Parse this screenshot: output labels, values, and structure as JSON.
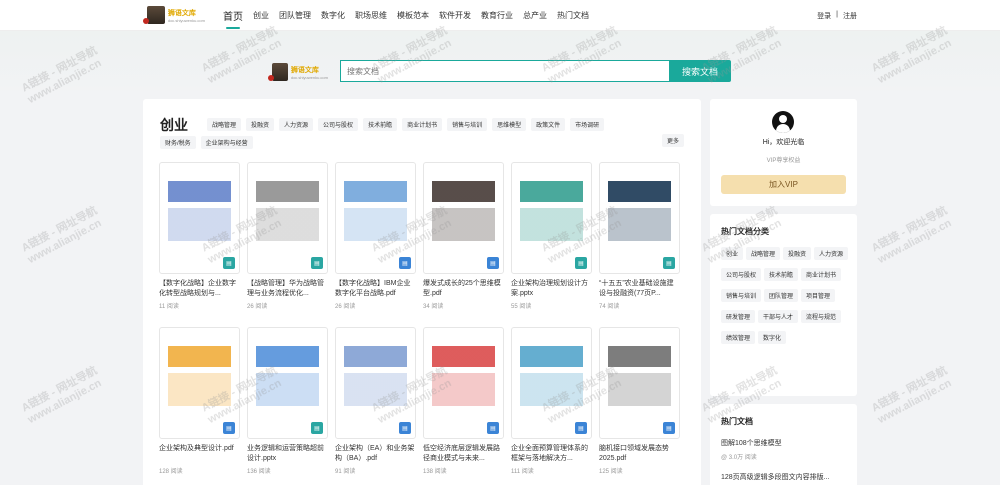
{
  "nav": {
    "logo_cn": "狮语文库",
    "logo_url": "doc.shiyuwenku.com",
    "items": [
      "首页",
      "创业",
      "团队管理",
      "数字化",
      "职场思维",
      "模板范本",
      "软件开发",
      "教育行业",
      "总产业",
      "热门文档"
    ],
    "login": "登录",
    "separator": "|",
    "register": "注册"
  },
  "search": {
    "placeholder": "搜索文档",
    "button": "搜索文档"
  },
  "category": {
    "title": "创业",
    "tags": [
      "战略管理",
      "投融资",
      "人力资源",
      "公司与股权",
      "技术前瞻",
      "商业计划书",
      "销售与培训",
      "思维模型",
      "政策文件",
      "市场调研"
    ],
    "tags_row2": [
      "财务/税务",
      "企业架构与经营"
    ],
    "more": "更多"
  },
  "docs": [
    {
      "title": "【数字化战略】企业数字化转型战略规划与...",
      "reads": "11 阅读",
      "fmt": "ppt",
      "color": "#5b7dc7"
    },
    {
      "title": "【战略管理】华为战略管理与业务流程优化...",
      "reads": "26 阅读",
      "fmt": "ppt",
      "color": "#888888"
    },
    {
      "title": "【数字化战略】IBM企业数字化平台战略.pdf",
      "reads": "26 阅读",
      "fmt": "pdf",
      "color": "#6aa0d8"
    },
    {
      "title": "爆发式成长的25个思维模型.pdf",
      "reads": "34 阅读",
      "fmt": "pdf",
      "color": "#3a2e2a"
    },
    {
      "title": "企业架构治理规划设计方案.pptx",
      "reads": "55 阅读",
      "fmt": "ppt",
      "color": "#2a9a8a"
    },
    {
      "title": "“十五五”农业基础设施建设与投融资(77页P...",
      "reads": "74 阅读",
      "fmt": "ppt",
      "color": "#0c2b4a"
    },
    {
      "title": "企业架构及典型设计.pdf",
      "reads": "128 阅读",
      "fmt": "pdf",
      "color": "#f0a830"
    },
    {
      "title": "业务逻辑和运营策略超前设计.pptx",
      "reads": "136 阅读",
      "fmt": "ppt",
      "color": "#4a8ad8"
    },
    {
      "title": "企业架构（EA）和业务架构（BA）.pdf",
      "reads": "91 阅读",
      "fmt": "pdf",
      "color": "#7a9ad0"
    },
    {
      "title": "低空经济底层逻辑发展路径商业模式与未来...",
      "reads": "138 阅读",
      "fmt": "pdf",
      "color": "#d84040"
    },
    {
      "title": "企业全面预算管理体系的框架与落地解决方...",
      "reads": "111 阅读",
      "fmt": "pdf",
      "color": "#4aa0c8"
    },
    {
      "title": "脑机接口领域发展态势2025.pdf",
      "reads": "125 阅读",
      "fmt": "pdf",
      "color": "#666666"
    }
  ],
  "user": {
    "greeting": "Hi，欢迎光临",
    "vip_text": "VIP尊享权益",
    "vip_button": "加入VIP"
  },
  "hot_categories": {
    "title": "热门文档分类",
    "tags": [
      "创业",
      "战略管理",
      "投融资",
      "人力资源",
      "公司与股权",
      "技术前瞻",
      "商业计划书",
      "销售与培训",
      "团队管理",
      "项目管理",
      "研发管理",
      "干部与人才",
      "流程与规范",
      "绩效管理",
      "数字化"
    ]
  },
  "hot_docs": {
    "title": "热门文档",
    "items": [
      {
        "title": "图解108个思维模型",
        "meta": "@ 3.0万 阅读"
      },
      {
        "title": "128页高级逻辑多段图文内容排版..."
      }
    ]
  },
  "watermark": {
    "line1": "A链接 - 网址导航",
    "line2": "www.alianjie.cn"
  }
}
